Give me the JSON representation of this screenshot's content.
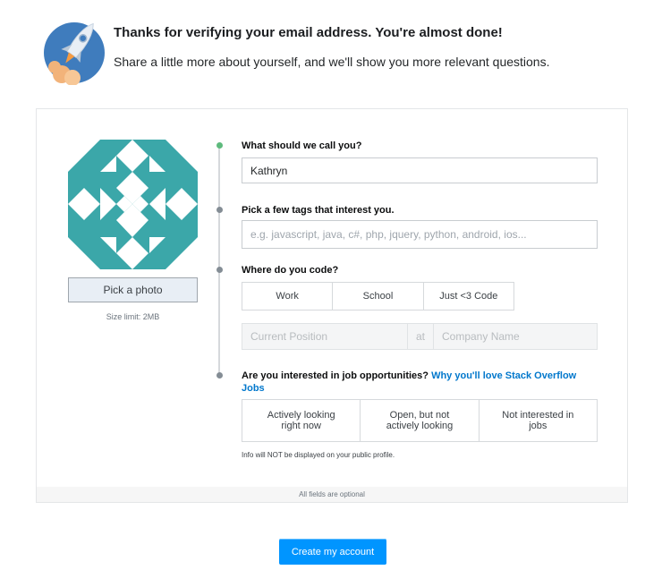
{
  "header": {
    "title": "Thanks for verifying your email address. You're almost done!",
    "subtitle": "Share a little more about yourself, and we'll show you more relevant questions."
  },
  "avatar": {
    "pick_photo_label": "Pick a photo",
    "size_limit": "Size limit: 2MB"
  },
  "name_field": {
    "label": "What should we call you?",
    "value": "Kathryn"
  },
  "tags_field": {
    "label": "Pick a few tags that interest you.",
    "placeholder": "e.g. javascript, java, c#, php, jquery, python, android, ios..."
  },
  "code_field": {
    "label": "Where do you code?",
    "options": [
      "Work",
      "School",
      "Just <3 Code"
    ],
    "position_placeholder": "Current Position",
    "at_label": "at",
    "company_placeholder": "Company Name"
  },
  "jobs_field": {
    "label": "Are you interested in job opportunities?",
    "link": "Why you'll love Stack Overflow Jobs",
    "options": [
      "Actively looking right now",
      "Open, but not actively looking",
      "Not interested in jobs"
    ],
    "note": "Info will NOT be displayed on your public profile."
  },
  "card_footer": "All fields are optional",
  "create_button": "Create my account",
  "colors": {
    "accent_blue": "#0095ff",
    "link_blue": "#0077cc",
    "avatar_teal": "#3ba7a9",
    "timeline_green": "#5eba7d",
    "timeline_gray": "#848d95"
  }
}
